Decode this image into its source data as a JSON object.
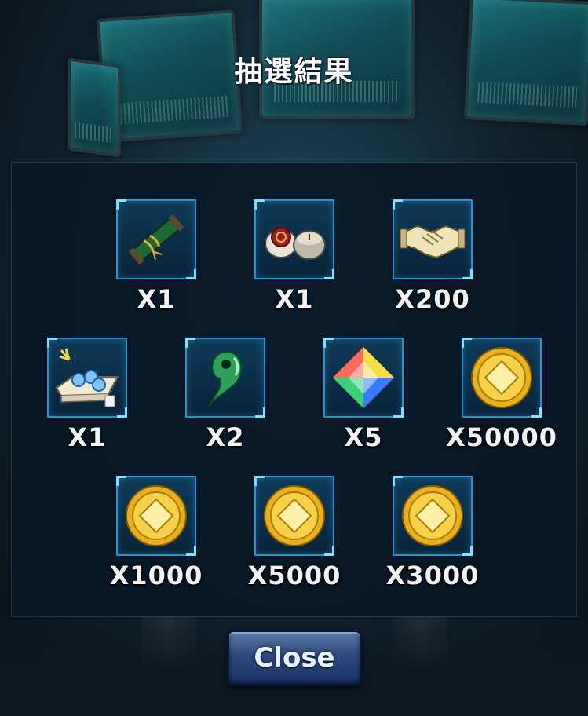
{
  "title": "抽選結果",
  "close_label": "Close",
  "rewards": [
    {
      "icon": "scroll-icon",
      "qty": "X1"
    },
    {
      "icon": "seal-stamp-icon",
      "qty": "X1"
    },
    {
      "icon": "handshake-icon",
      "qty": "X200"
    },
    {
      "icon": "orbs-on-cushion-icon",
      "qty": "X1"
    },
    {
      "icon": "jade-magatama-icon",
      "qty": "X2"
    },
    {
      "icon": "rainbow-crystal-icon",
      "qty": "X5"
    },
    {
      "icon": "gold-coin-icon",
      "qty": "X50000"
    },
    {
      "icon": "gold-coin-icon",
      "qty": "X1000"
    },
    {
      "icon": "gold-coin-icon",
      "qty": "X5000"
    },
    {
      "icon": "gold-coin-icon",
      "qty": "X3000"
    }
  ]
}
